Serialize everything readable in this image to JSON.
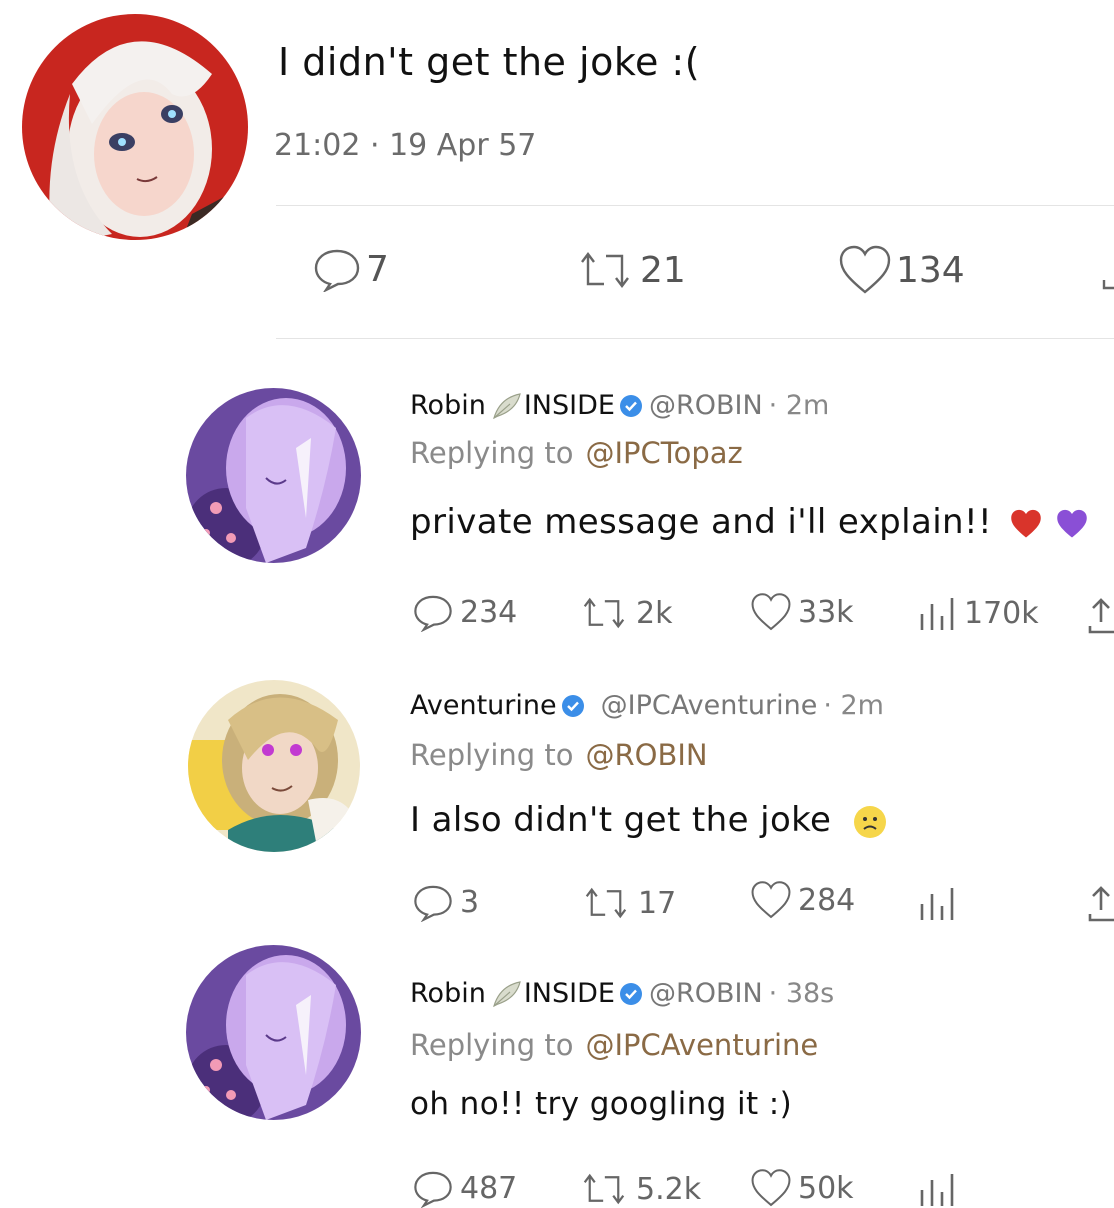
{
  "main": {
    "text": "I didn't get the joke :(",
    "timestamp": "21:02 · 19 Apr 57",
    "stats": {
      "replies": "7",
      "retweets": "21",
      "likes": "134"
    }
  },
  "replies": [
    {
      "name": "Robin",
      "tag": "INSIDE",
      "handle": "@ROBIN",
      "time": "· 2m",
      "replying_label": "Replying to",
      "replying_to": "@IPCTopaz",
      "text": "private message and i'll explain!!",
      "stats": {
        "replies": "234",
        "retweets": "2k",
        "likes": "33k",
        "views": "170k"
      }
    },
    {
      "name": "Aventurine",
      "handle": "@IPCAventurine",
      "time": "· 2m",
      "replying_label": "Replying to",
      "replying_to": "@ROBIN",
      "text": "I also didn't get the joke",
      "stats": {
        "replies": "3",
        "retweets": "17",
        "likes": "284",
        "views": ""
      }
    },
    {
      "name": "Robin",
      "tag": "INSIDE",
      "handle": "@ROBIN",
      "time": "· 38s",
      "replying_label": "Replying to",
      "replying_to": "@IPCAventurine",
      "text": "oh no!! try googling it :)",
      "stats": {
        "replies": "487",
        "retweets": "5.2k",
        "likes": "50k",
        "views": ""
      }
    }
  ],
  "colors": {
    "verified": "#3b8ee8",
    "mention": "#8a6a45",
    "heart_red": "#d9342b",
    "heart_purple": "#8a4fd6"
  }
}
